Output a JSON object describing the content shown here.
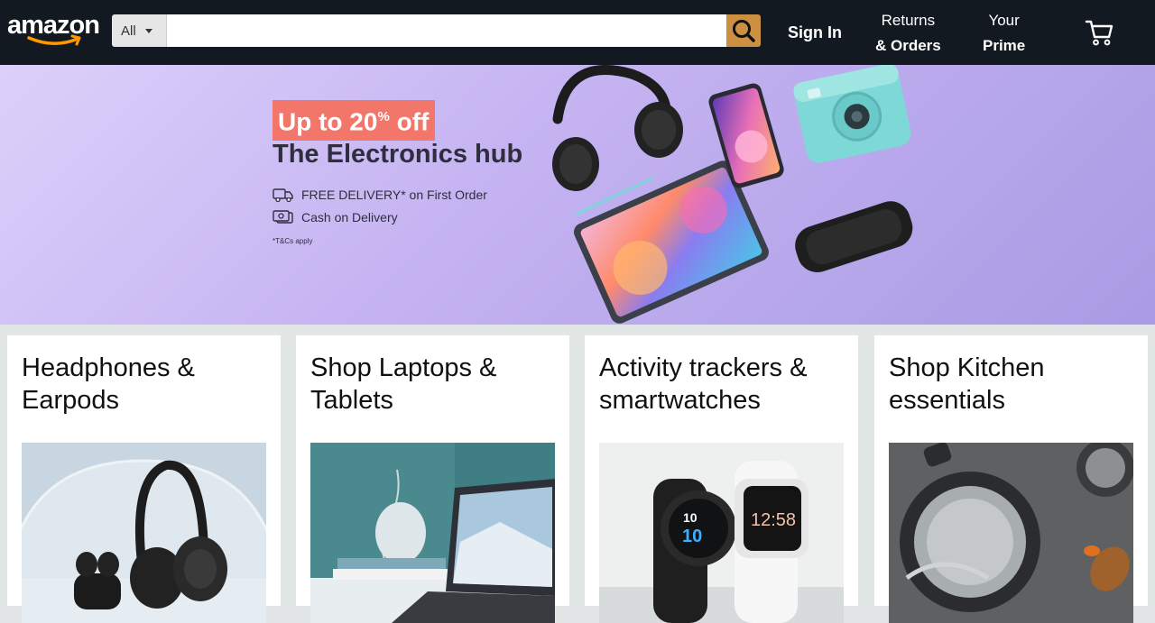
{
  "nav": {
    "logo_text": "amazon",
    "search_category": "All",
    "search_placeholder": "",
    "sign_in": "Sign In",
    "returns_top": "Returns",
    "returns_bottom": "& Orders",
    "prime_top": "Your",
    "prime_bottom": "Prime",
    "accent": "#cd9042",
    "background": "#131921"
  },
  "hero": {
    "badge": "Up to 20",
    "badge_sup": "%",
    "badge_suffix": " off",
    "title": "The Electronics hub",
    "perk1": "FREE DELIVERY* on First Order",
    "perk2": "Cash on Delivery",
    "tnc": "*T&Cs apply",
    "badge_color": "#f2776a"
  },
  "cards": [
    {
      "title": "Headphones & Earpods",
      "icon": "headphones-image"
    },
    {
      "title": "Shop Laptops & Tablets",
      "icon": "laptop-image"
    },
    {
      "title": "Activity trackers & smartwatches",
      "icon": "smartwatch-image"
    },
    {
      "title": "Shop Kitchen essentials",
      "icon": "cookware-image"
    }
  ],
  "watch_display": {
    "left_top": "10",
    "left_bottom": "10",
    "right_time": "12:58"
  }
}
